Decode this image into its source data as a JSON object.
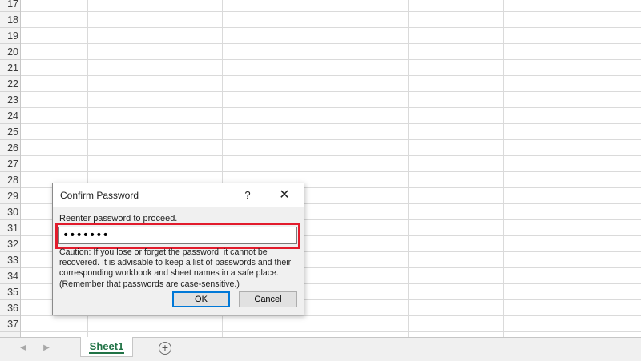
{
  "sheet": {
    "rows": [
      "17",
      "18",
      "19",
      "20",
      "21",
      "22",
      "23",
      "24",
      "25",
      "26",
      "27",
      "28",
      "29",
      "30",
      "31",
      "32",
      "33",
      "34",
      "35",
      "36",
      "37"
    ],
    "tabs": [
      {
        "label": "Sheet1",
        "active": true
      }
    ],
    "add_sheet_icon": "plus-circle-icon",
    "nav_prev_icon": "chevron-left-icon",
    "nav_next_icon": "chevron-right-icon"
  },
  "dialog": {
    "title": "Confirm Password",
    "help_label": "?",
    "close_label": "✕",
    "prompt": "Reenter password to proceed.",
    "password_value": "•••••••",
    "caution": "Caution: If you lose or forget the password, it cannot be recovered. It is advisable to keep a list of passwords and their corresponding workbook and sheet names in a safe place. (Remember that passwords are case-sensitive.)",
    "ok_label": "OK",
    "cancel_label": "Cancel",
    "highlight_color": "#e21b2c"
  },
  "colors": {
    "excel_green": "#217346",
    "focus_blue": "#0078d7"
  }
}
